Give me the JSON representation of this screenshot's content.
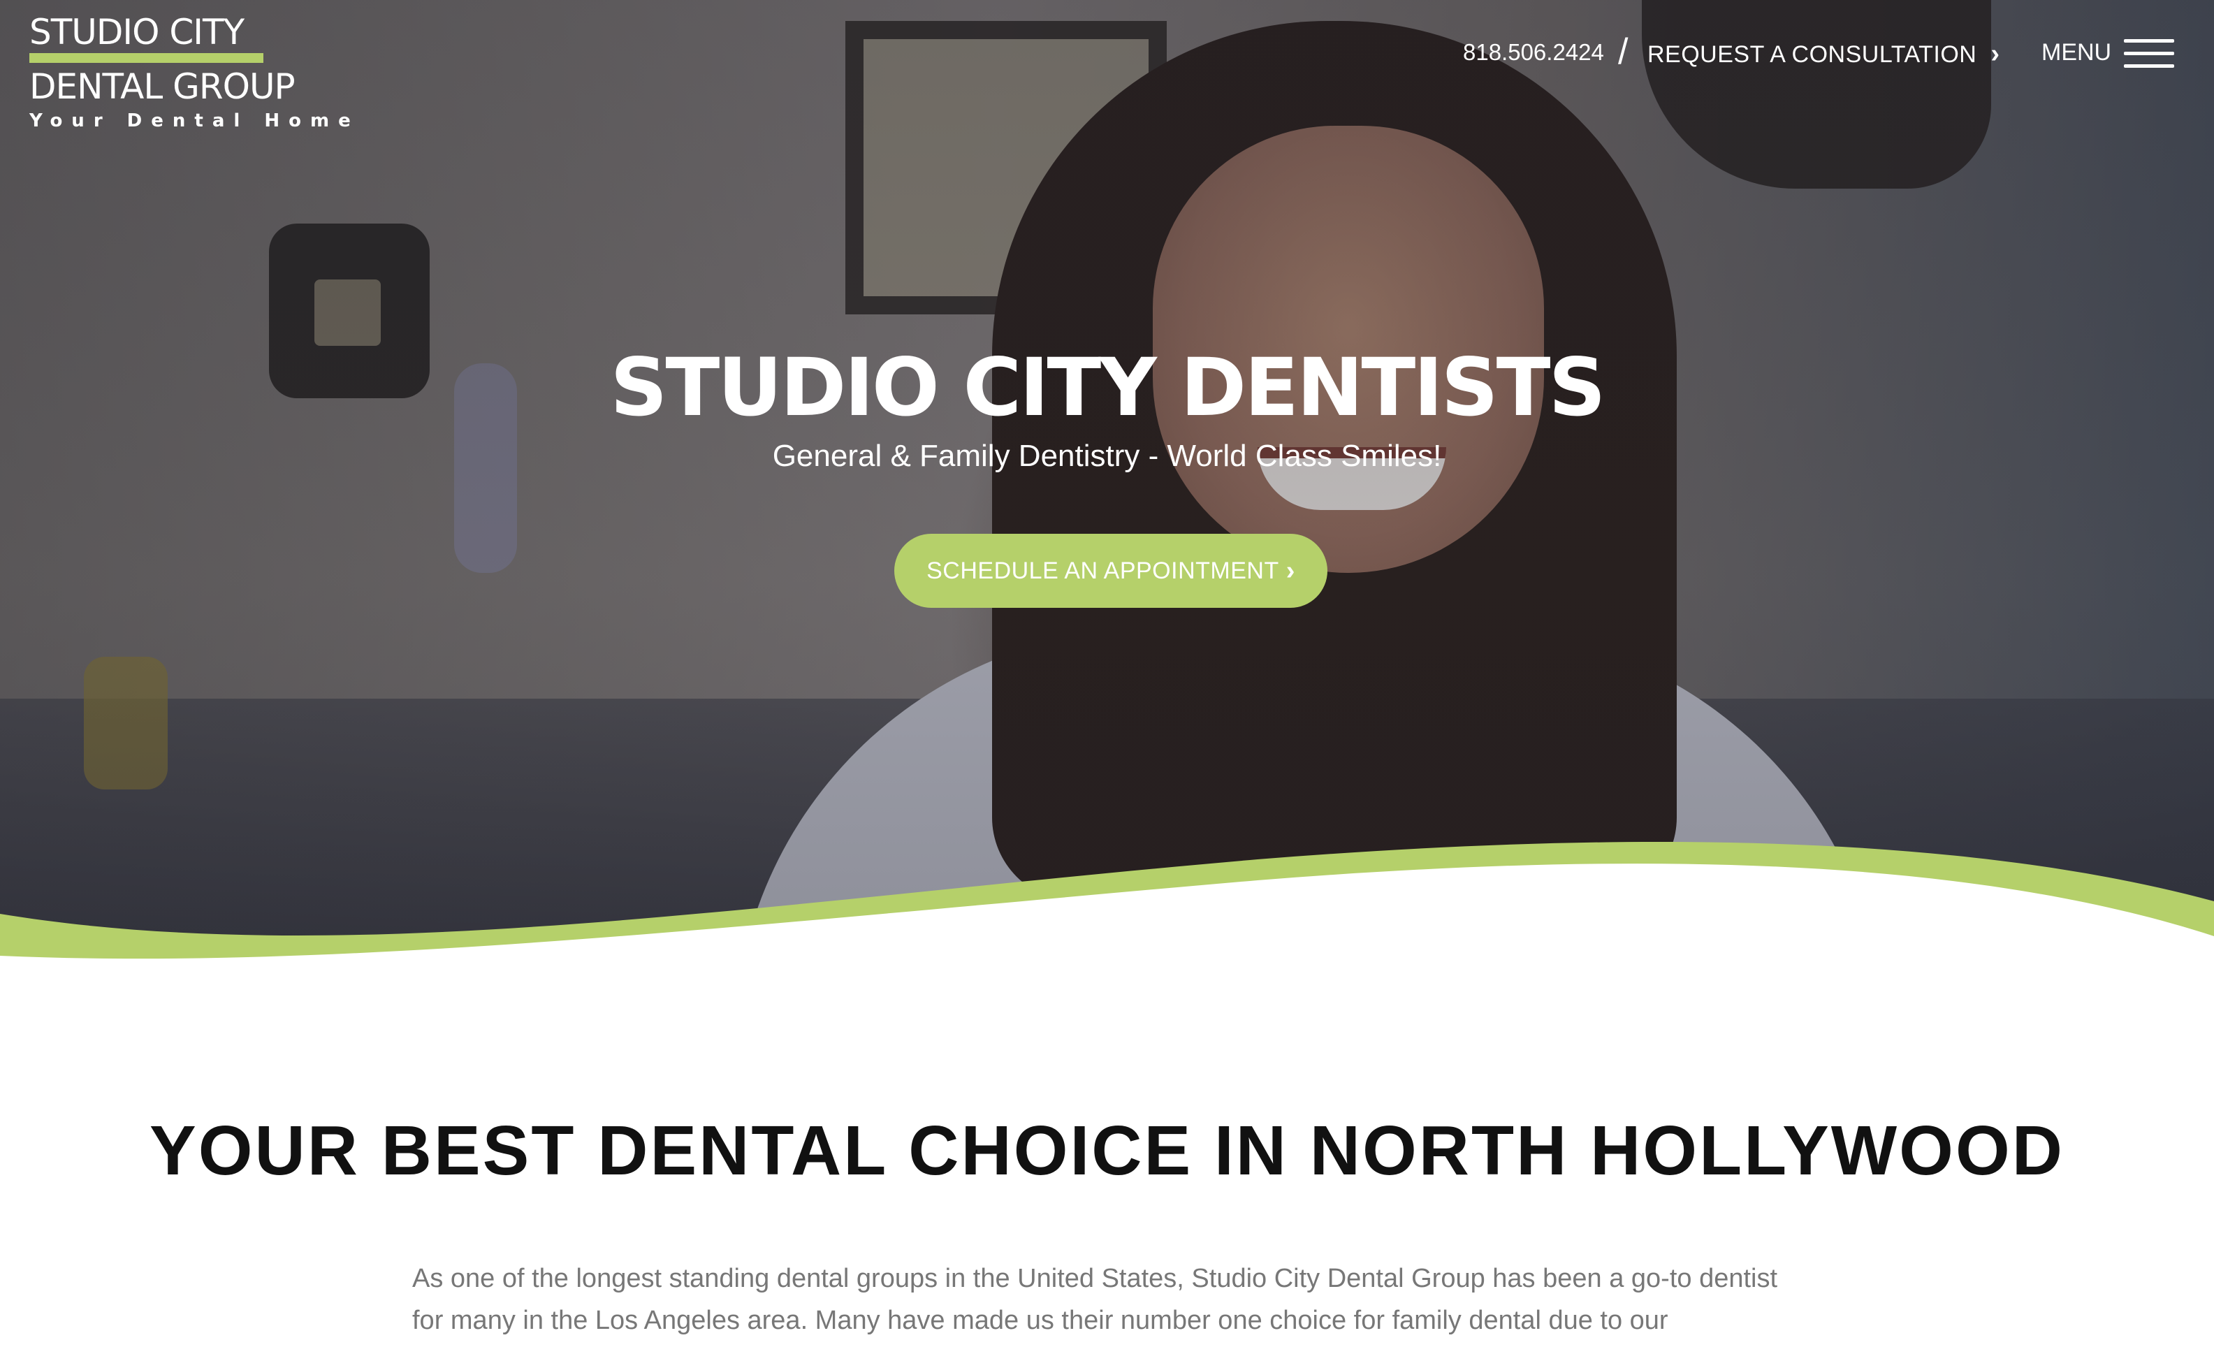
{
  "brand": {
    "line1": "STUDIO CITY",
    "line2": "DENTAL GROUP",
    "tagline": "Your Dental Home",
    "accent_color": "#b5d06a"
  },
  "header": {
    "phone": "818.506.2424",
    "separator": "/",
    "consult_label": "REQUEST A CONSULTATION",
    "chevron": "›",
    "menu_label": "MENU",
    "menu_icon": "hamburger-icon"
  },
  "hero": {
    "title": "STUDIO CITY DENTISTS",
    "subtitle": "General & Family Dentistry - World Class Smiles!",
    "cta_label": "SCHEDULE AN APPOINTMENT",
    "cta_chevron": "›"
  },
  "intro": {
    "heading": "YOUR BEST DENTAL CHOICE IN NORTH HOLLYWOOD",
    "body": "As one of the longest standing dental groups in the United States, Studio City Dental Group has been a go-to dentist for many in the Los Angeles area. Many have made us their number one choice for family dental due to our"
  }
}
